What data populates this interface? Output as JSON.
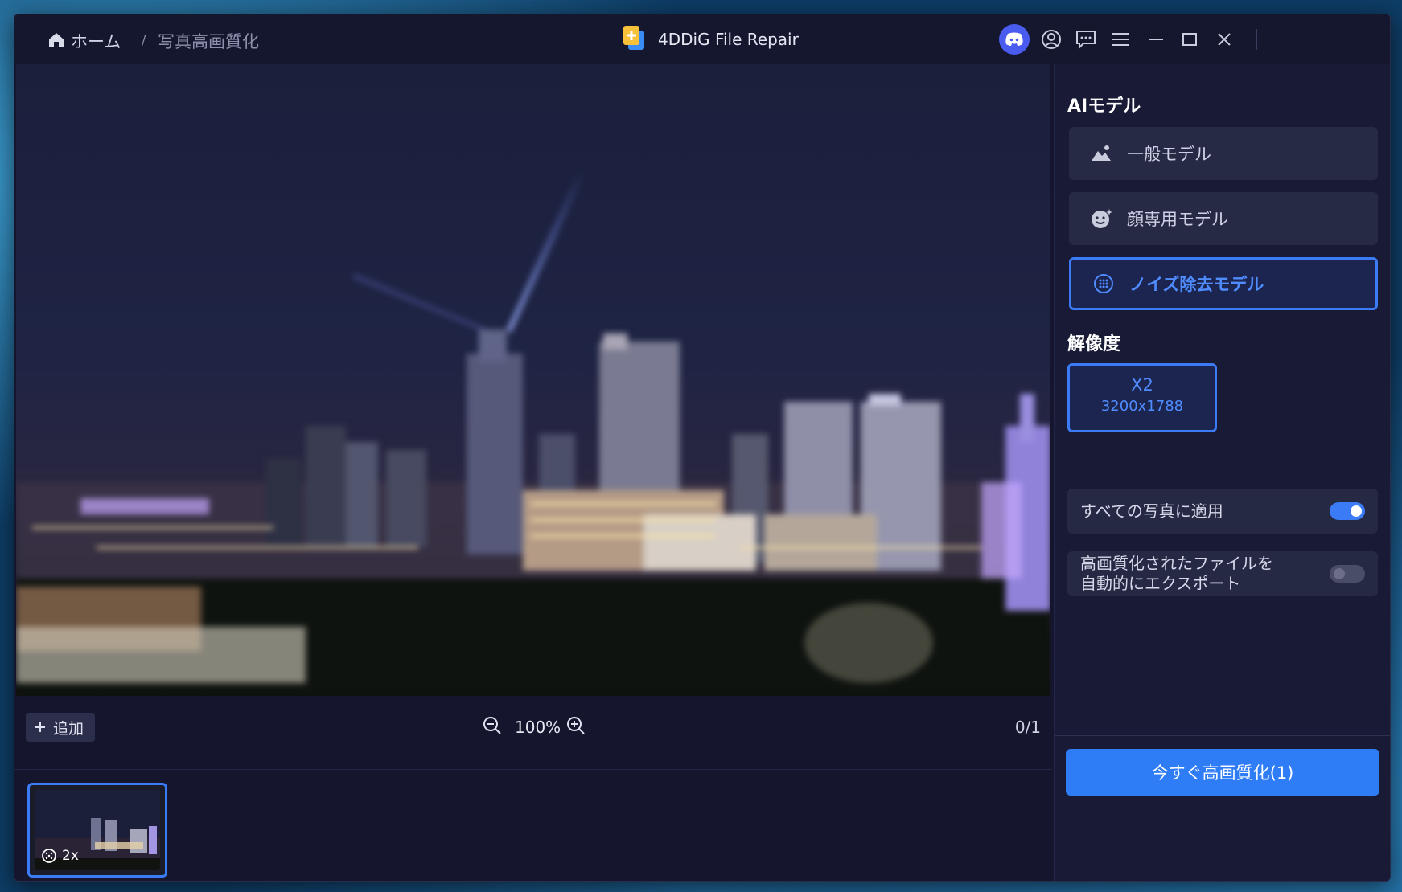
{
  "breadcrumb": {
    "home": "ホーム",
    "separator": "/",
    "current": "写真高画質化"
  },
  "app": {
    "title": "4DDiG File Repair"
  },
  "titlebar_icons": [
    "discord-icon",
    "account-icon",
    "feedback-icon",
    "menu-icon",
    "minimize-icon",
    "maximize-icon",
    "close-icon"
  ],
  "controls": {
    "add_label": "追加",
    "zoom": "100%",
    "page_count": "0/1"
  },
  "thumbnail": {
    "scale_badge": "2x"
  },
  "panel": {
    "ai_model_title": "AIモデル",
    "models": [
      {
        "label": "一般モデル",
        "icon": "landscape-icon",
        "active": false
      },
      {
        "label": "顔専用モデル",
        "icon": "face-icon",
        "active": false
      },
      {
        "label": "ノイズ除去モデル",
        "icon": "denoise-icon",
        "active": true
      }
    ],
    "resolution_title": "解像度",
    "resolution": {
      "scale": "X2",
      "size": "3200x1788"
    },
    "options": [
      {
        "line1": "すべての写真に適用",
        "line2": "",
        "enabled": true
      },
      {
        "line1": "高画質化されたファイルを",
        "line2": "自動的にエクスポート",
        "enabled": false
      }
    ],
    "enhance_button": "今すぐ高画質化(1)"
  },
  "colors": {
    "accent": "#3b7bf5",
    "window_bg": "#15162e",
    "panel_bg": "#181a36"
  }
}
